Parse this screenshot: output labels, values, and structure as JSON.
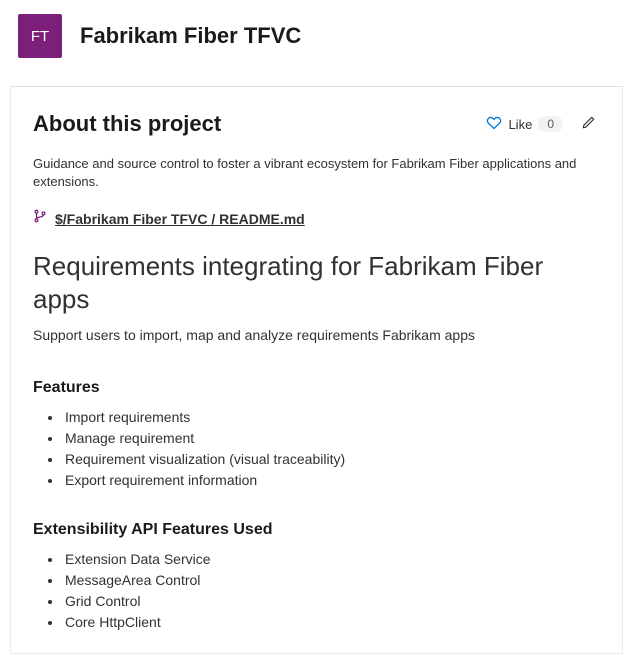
{
  "header": {
    "avatar_initials": "FT",
    "project_title": "Fabrikam Fiber TFVC"
  },
  "about": {
    "heading": "About this project",
    "like_label": "Like",
    "like_count": "0",
    "description": "Guidance and source control to foster a vibrant ecosystem for Fabrikam Fiber applications and extensions.",
    "readme_path": "$/Fabrikam Fiber TFVC / README.md"
  },
  "readme": {
    "title": "Requirements integrating for Fabrikam Fiber apps",
    "subtitle": "Support users to import, map and analyze requirements Fabrikam apps",
    "features_heading": "Features",
    "features": [
      "Import requirements",
      "Manage requirement",
      "Requirement visualization (visual traceability)",
      "Export requirement information"
    ],
    "api_heading": "Extensibility API Features Used",
    "api_items": [
      "Extension Data Service",
      "MessageArea Control",
      "Grid Control",
      "Core HttpClient"
    ]
  }
}
